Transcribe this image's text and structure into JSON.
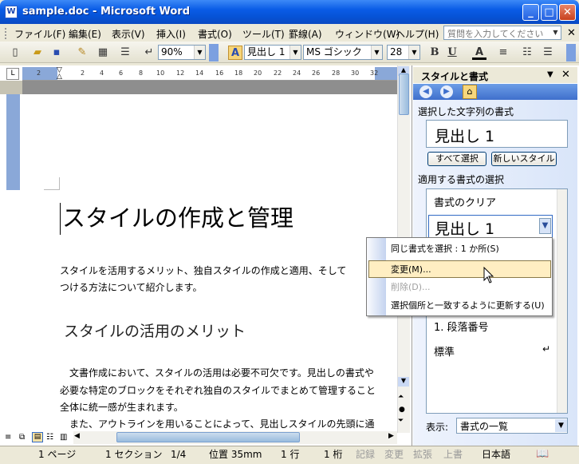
{
  "window": {
    "title": "sample.doc - Microsoft Word",
    "app_icon": "word-doc-icon"
  },
  "menubar": {
    "items": [
      "ファイル(F)",
      "編集(E)",
      "表示(V)",
      "挿入(I)",
      "書式(O)",
      "ツール(T)",
      "罫線(A)",
      "ウィンドウ(W)",
      "ヘルプ(H)"
    ],
    "help_placeholder": "質問を入力してください"
  },
  "toolbar": {
    "zoom": "90%",
    "style": "見出し 1",
    "font": "MS ゴシック",
    "size": "28",
    "bold": "B",
    "underline": "U",
    "fontcolor": "A"
  },
  "ruler": {
    "ticks": [
      "2",
      "2",
      "4",
      "6",
      "8",
      "10",
      "12",
      "14",
      "16",
      "18",
      "20",
      "22",
      "24",
      "26",
      "28",
      "30",
      "32"
    ]
  },
  "document": {
    "title": "スタイルの作成と管理",
    "intro_line1": "スタイルを活用するメリット、独自スタイルの作成と適用、そして",
    "intro_line2": "つける方法について紹介します。",
    "heading": "スタイルの活用のメリット",
    "para1_line1": "　文書作成において、スタイルの活用は必要不可欠です。見出しの書式や",
    "para1_line2": "必要な特定のブロックをそれぞれ独自のスタイルでまとめて管理すること",
    "para1_line3": "全体に統一感が生まれます。",
    "para2_line1": "　また、アウトラインを用いることによって、見出しスタイルの先頭に通"
  },
  "task_pane": {
    "title": "スタイルと書式",
    "selected_label": "選択した文字列の書式",
    "selected_style": "見出し 1",
    "select_all_btn": "すべて選択",
    "new_style_btn": "新しいスタイル",
    "apply_label": "適用する書式の選択",
    "styles": [
      "書式のクリア",
      "見出し 1",
      "1.  段落番号",
      "標準"
    ],
    "show_label": "表示:",
    "show_value": "書式の一覧"
  },
  "context_menu": {
    "items": [
      {
        "label": "同じ書式を選択 : 1 か所(S)",
        "enabled": true
      },
      {
        "label": "変更(M)...",
        "enabled": true,
        "highlighted": true
      },
      {
        "label": "削除(D)...",
        "enabled": false
      },
      {
        "label": "選択個所と一致するように更新する(U)",
        "enabled": true
      }
    ]
  },
  "statusbar": {
    "page": "1 ページ",
    "section": "1 セクション",
    "pages": "1/4",
    "position": "位置  35mm",
    "line": "1 行",
    "column": "1 桁",
    "rec": "記録",
    "trk": "変更",
    "ext": "拡張",
    "ovr": "上書",
    "language": "日本語"
  }
}
